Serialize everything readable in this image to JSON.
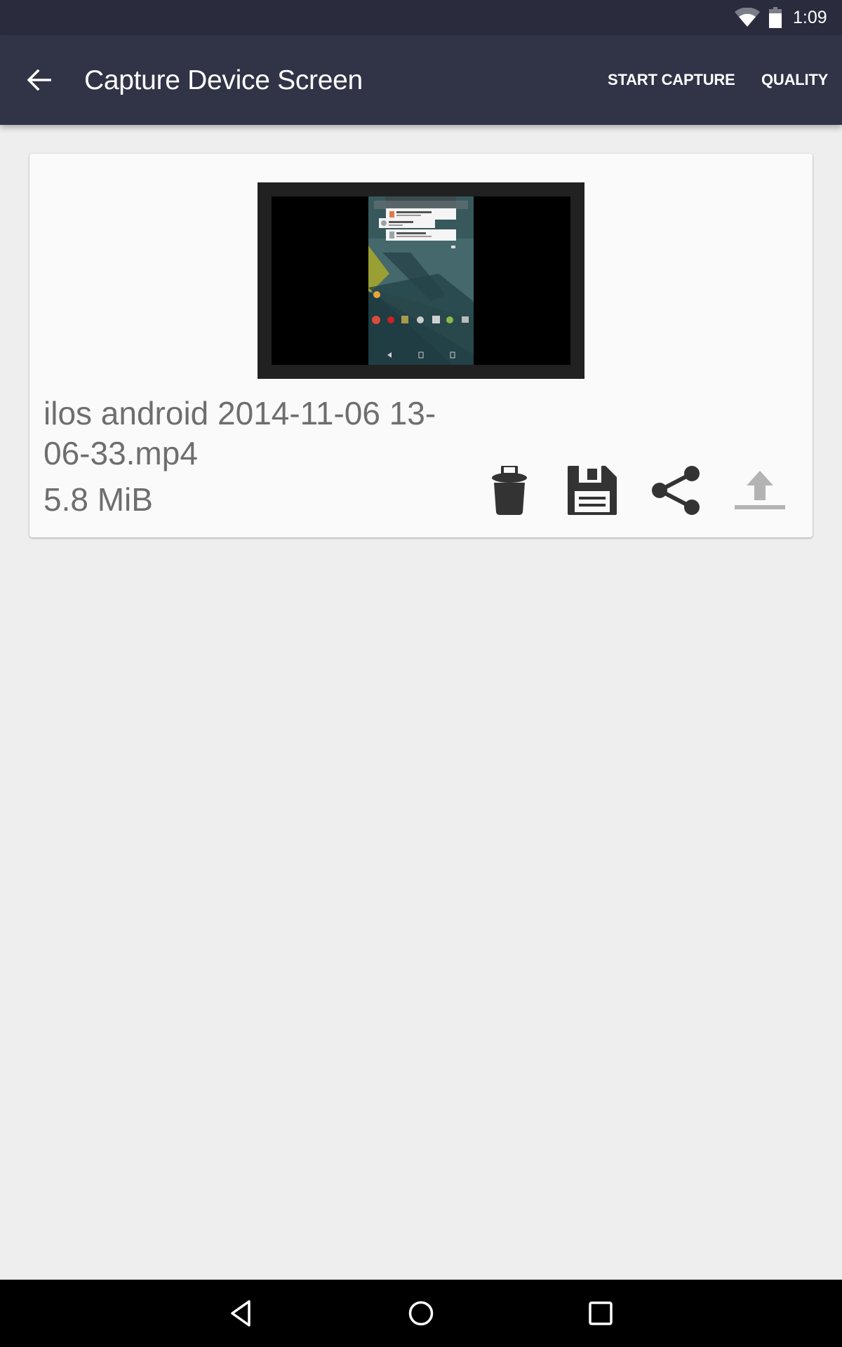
{
  "status_bar": {
    "time": "1:09",
    "icons": [
      "wifi-icon",
      "battery-icon"
    ]
  },
  "toolbar": {
    "back_icon": "arrow-back-icon",
    "title": "Capture Device Screen",
    "actions": [
      {
        "label": "START CAPTURE"
      },
      {
        "label": "QUALITY"
      }
    ]
  },
  "recording": {
    "thumbnail": "video-thumbnail",
    "file_name": "ilos android 2014-11-06 13-06-33.mp4",
    "file_size": "5.8 MiB",
    "actions": [
      {
        "name": "delete",
        "icon": "trash-icon",
        "enabled": true
      },
      {
        "name": "save",
        "icon": "floppy-disk-icon",
        "enabled": true
      },
      {
        "name": "share",
        "icon": "share-icon",
        "enabled": true
      },
      {
        "name": "upload",
        "icon": "upload-icon",
        "enabled": false
      }
    ]
  },
  "nav_bar": {
    "buttons": [
      "back-triangle-icon",
      "home-circle-icon",
      "recents-square-icon"
    ]
  },
  "colors": {
    "status_bar": "#2a2c3e",
    "toolbar": "#313347",
    "background": "#eeeeee",
    "card": "#fafafa",
    "text_secondary": "#6e6e6e",
    "icon_active": "#333333",
    "icon_disabled": "#b3b3b3"
  }
}
